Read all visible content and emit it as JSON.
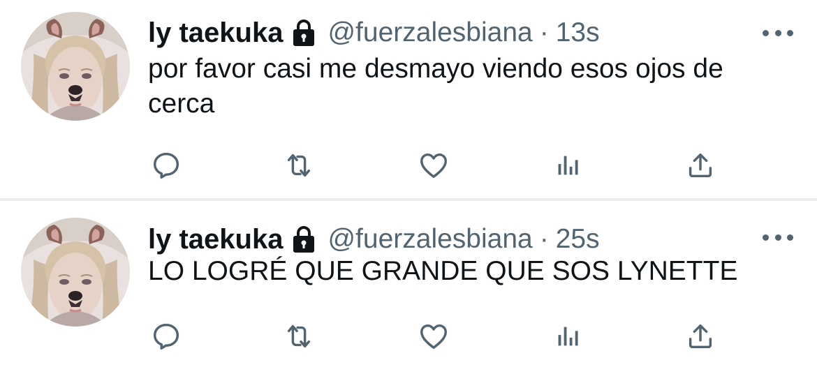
{
  "tweets": [
    {
      "author": {
        "name": "ly taekuka",
        "handle": "@fuerzalesbiana",
        "protected": true,
        "avatar_icon": "dog-filter-selfie-avatar"
      },
      "separator": "·",
      "time": "13s",
      "text": "por favor casi me desmayo viendo esos ojos de cerca",
      "actions": [
        "reply-icon",
        "retweet-icon",
        "like-icon",
        "views-icon",
        "share-icon"
      ]
    },
    {
      "author": {
        "name": "ly taekuka",
        "handle": "@fuerzalesbiana",
        "protected": true,
        "avatar_icon": "dog-filter-selfie-avatar"
      },
      "separator": "·",
      "time": "25s",
      "text": "LO LOGRÉ QUE GRANDE QUE SOS LYNETTE",
      "actions": [
        "reply-icon",
        "retweet-icon",
        "like-icon",
        "views-icon",
        "share-icon"
      ]
    }
  ],
  "colors": {
    "text": "#0f1419",
    "secondary": "#536471",
    "divider": "#eceef0",
    "background": "#ffffff"
  }
}
